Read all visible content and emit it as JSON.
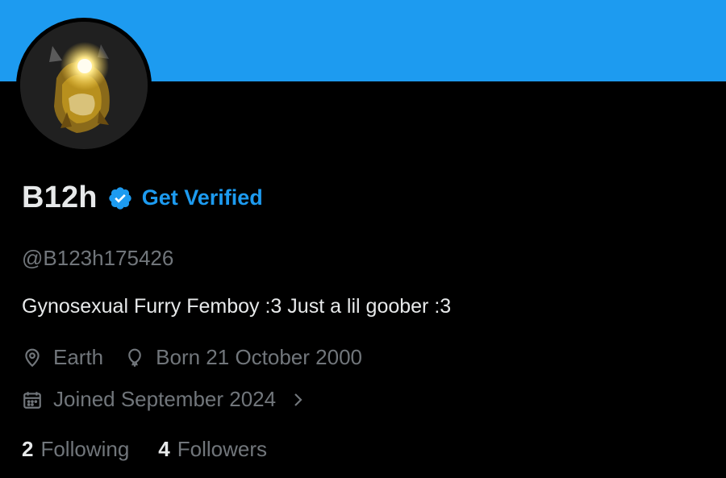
{
  "profile": {
    "display_name": "B12h",
    "verified_link": "Get Verified",
    "handle": "@B123h175426",
    "bio": "Gynosexual Furry Femboy :3 Just a lil goober :3",
    "location": "Earth",
    "birth_date": "Born 21 October 2000",
    "joined": "Joined September 2024"
  },
  "stats": {
    "following_count": "2",
    "following_label": "Following",
    "followers_count": "4",
    "followers_label": "Followers"
  },
  "icons": {
    "verified": "verified-check-icon",
    "location": "location-pin-icon",
    "birthday": "balloon-icon",
    "joined": "calendar-icon",
    "expand": "chevron-right-icon"
  },
  "colors": {
    "banner": "#1d9bf0",
    "background": "#000000",
    "accent": "#1d9bf0",
    "primary_text": "#e7e9ea",
    "secondary_text": "#71767b"
  }
}
